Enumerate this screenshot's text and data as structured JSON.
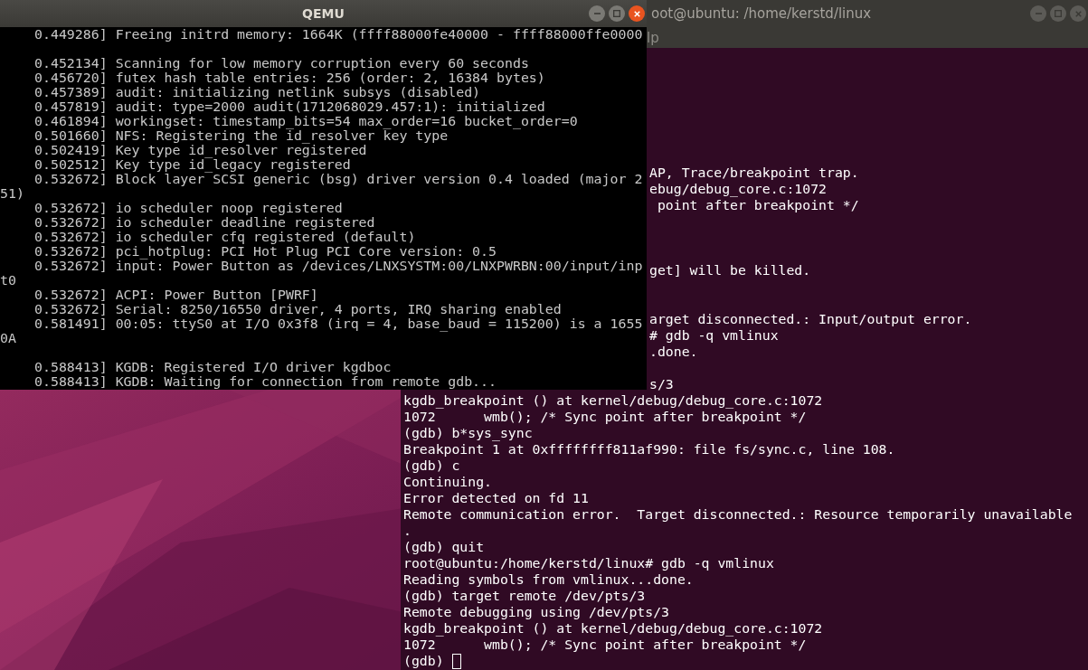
{
  "windows": [
    {
      "kind": "emulator",
      "title": "QEMU",
      "active": true,
      "lines": [
        {
          "kind": "log",
          "text": "0.449286] Freeing initrd memory: 1664K (ffff88000fe40000 - ffff88000ffe0000"
        },
        {
          "kind": "blank"
        },
        {
          "kind": "log",
          "text": "0.452134] Scanning for low memory corruption every 60 seconds"
        },
        {
          "kind": "log",
          "text": "0.456720] futex hash table entries: 256 (order: 2, 16384 bytes)"
        },
        {
          "kind": "log",
          "text": "0.457389] audit: initializing netlink subsys (disabled)"
        },
        {
          "kind": "log",
          "text": "0.457819] audit: type=2000 audit(1712068029.457:1): initialized"
        },
        {
          "kind": "log",
          "text": "0.461894] workingset: timestamp_bits=54 max_order=16 bucket_order=0"
        },
        {
          "kind": "log",
          "text": "0.501660] NFS: Registering the id_resolver key type"
        },
        {
          "kind": "log",
          "text": "0.502419] Key type id_resolver registered"
        },
        {
          "kind": "log",
          "text": "0.502512] Key type id_legacy registered"
        },
        {
          "kind": "log",
          "text": "0.532672] Block layer SCSI generic (bsg) driver version 0.4 loaded (major 2"
        },
        {
          "kind": "wrap",
          "text": "51)"
        },
        {
          "kind": "log",
          "text": "0.532672] io scheduler noop registered"
        },
        {
          "kind": "log",
          "text": "0.532672] io scheduler deadline registered"
        },
        {
          "kind": "log",
          "text": "0.532672] io scheduler cfq registered (default)"
        },
        {
          "kind": "log",
          "text": "0.532672] pci_hotplug: PCI Hot Plug PCI Core version: 0.5"
        },
        {
          "kind": "log",
          "text": "0.532672] input: Power Button as /devices/LNXSYSTM:00/LNXPWRBN:00/input/inp"
        },
        {
          "kind": "wrap",
          "text": "t0"
        },
        {
          "kind": "log",
          "text": "0.532672] ACPI: Power Button [PWRF]"
        },
        {
          "kind": "log",
          "text": "0.532672] Serial: 8250/16550 driver, 4 ports, IRQ sharing enabled"
        },
        {
          "kind": "log",
          "text": "0.581491] 00:05: ttyS0 at I/O 0x3f8 (irq = 4, base_baud = 115200) is a 1655"
        },
        {
          "kind": "wrap",
          "text": "0A"
        },
        {
          "kind": "blank"
        },
        {
          "kind": "log",
          "text": "0.588413] KGDB: Registered I/O driver kgdboc"
        },
        {
          "kind": "log",
          "text": "0.588413] KGDB: Waiting for connection from remote gdb..."
        }
      ]
    },
    {
      "kind": "terminal",
      "title": "oot@ubuntu: /home/kerstd/linux",
      "active": false,
      "menu": [
        {
          "label": "lp"
        }
      ],
      "lines": [
        {
          "kind": "tail",
          "text": "AP, Trace/breakpoint trap."
        },
        {
          "kind": "tail",
          "text": "ebug/debug_core.c:1072"
        },
        {
          "kind": "tail",
          "text": " point after breakpoint */"
        },
        {
          "kind": "blank"
        },
        {
          "kind": "blank"
        },
        {
          "kind": "blank"
        },
        {
          "kind": "tail",
          "text": "get] will be killed."
        },
        {
          "kind": "blank"
        },
        {
          "kind": "blank"
        },
        {
          "kind": "tail",
          "text": "arget disconnected.: Input/output error."
        },
        {
          "kind": "tail",
          "text": "# gdb -q vmlinux"
        },
        {
          "kind": "tail",
          "text": ".done."
        },
        {
          "kind": "blank"
        },
        {
          "kind": "tail",
          "text": "s/3"
        },
        {
          "kind": "full",
          "text": "kgdb_breakpoint () at kernel/debug/debug_core.c:1072"
        },
        {
          "kind": "full",
          "text": "1072      wmb(); /* Sync point after breakpoint */"
        },
        {
          "kind": "full",
          "text": "(gdb) b*sys_sync"
        },
        {
          "kind": "full",
          "text": "Breakpoint 1 at 0xffffffff811af990: file fs/sync.c, line 108."
        },
        {
          "kind": "full",
          "text": "(gdb) c"
        },
        {
          "kind": "full",
          "text": "Continuing."
        },
        {
          "kind": "full",
          "text": "Error detected on fd 11"
        },
        {
          "kind": "full",
          "text": "Remote communication error.  Target disconnected.: Resource temporarily unavailable"
        },
        {
          "kind": "full",
          "text": "."
        },
        {
          "kind": "full",
          "text": "(gdb) quit"
        },
        {
          "kind": "full",
          "text": "root@ubuntu:/home/kerstd/linux# gdb -q vmlinux"
        },
        {
          "kind": "full",
          "text": "Reading symbols from vmlinux...done."
        },
        {
          "kind": "full",
          "text": "(gdb) target remote /dev/pts/3"
        },
        {
          "kind": "full",
          "text": "Remote debugging using /dev/pts/3"
        },
        {
          "kind": "full",
          "text": "kgdb_breakpoint () at kernel/debug/debug_core.c:1072"
        },
        {
          "kind": "full",
          "text": "1072      wmb(); /* Sync point after breakpoint */"
        },
        {
          "kind": "prompt",
          "text": "(gdb)"
        }
      ]
    }
  ]
}
